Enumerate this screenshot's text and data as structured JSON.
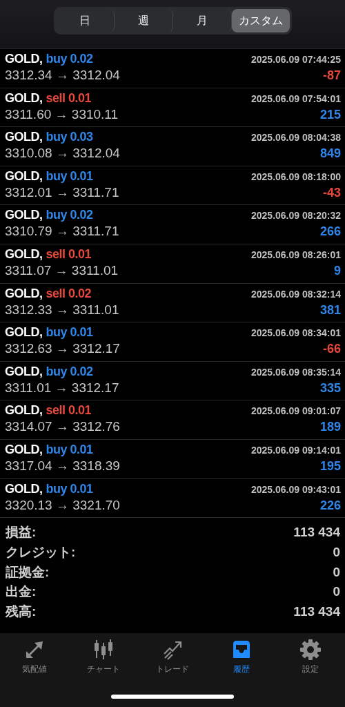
{
  "period_tabs": [
    {
      "label": "日",
      "selected": false
    },
    {
      "label": "週",
      "selected": false
    },
    {
      "label": "月",
      "selected": false
    },
    {
      "label": "カスタム",
      "selected": true
    }
  ],
  "trades": [
    {
      "symbol": "GOLD,",
      "kind": "buy",
      "volume": "buy 0.02",
      "time": "2025.06.09 07:44:25",
      "prices": "3312.34 → 3312.04",
      "profit": "-87",
      "color": "#e5483c"
    },
    {
      "symbol": "GOLD,",
      "kind": "sell",
      "volume": "sell 0.01",
      "time": "2025.06.09 07:54:01",
      "prices": "3311.60 → 3310.11",
      "profit": "215",
      "color": "#2f86e8"
    },
    {
      "symbol": "GOLD,",
      "kind": "buy",
      "volume": "buy 0.03",
      "time": "2025.06.09 08:04:38",
      "prices": "3310.08 → 3312.04",
      "profit": "849",
      "color": "#2f86e8"
    },
    {
      "symbol": "GOLD,",
      "kind": "buy",
      "volume": "buy 0.01",
      "time": "2025.06.09 08:18:00",
      "prices": "3312.01 → 3311.71",
      "profit": "-43",
      "color": "#e5483c"
    },
    {
      "symbol": "GOLD,",
      "kind": "buy",
      "volume": "buy 0.02",
      "time": "2025.06.09 08:20:32",
      "prices": "3310.79 → 3311.71",
      "profit": "266",
      "color": "#2f86e8"
    },
    {
      "symbol": "GOLD,",
      "kind": "sell",
      "volume": "sell 0.01",
      "time": "2025.06.09 08:26:01",
      "prices": "3311.07 → 3311.01",
      "profit": "9",
      "color": "#2f86e8"
    },
    {
      "symbol": "GOLD,",
      "kind": "sell",
      "volume": "sell 0.02",
      "time": "2025.06.09 08:32:14",
      "prices": "3312.33 → 3311.01",
      "profit": "381",
      "color": "#2f86e8"
    },
    {
      "symbol": "GOLD,",
      "kind": "buy",
      "volume": "buy 0.01",
      "time": "2025.06.09 08:34:01",
      "prices": "3312.63 → 3312.17",
      "profit": "-66",
      "color": "#e5483c"
    },
    {
      "symbol": "GOLD,",
      "kind": "buy",
      "volume": "buy 0.02",
      "time": "2025.06.09 08:35:14",
      "prices": "3311.01 → 3312.17",
      "profit": "335",
      "color": "#2f86e8"
    },
    {
      "symbol": "GOLD,",
      "kind": "sell",
      "volume": "sell 0.01",
      "time": "2025.06.09 09:01:07",
      "prices": "3314.07 → 3312.76",
      "profit": "189",
      "color": "#2f86e8"
    },
    {
      "symbol": "GOLD,",
      "kind": "buy",
      "volume": "buy 0.01",
      "time": "2025.06.09 09:14:01",
      "prices": "3317.04 → 3318.39",
      "profit": "195",
      "color": "#2f86e8"
    },
    {
      "symbol": "GOLD,",
      "kind": "buy",
      "volume": "buy 0.01",
      "time": "2025.06.09 09:43:01",
      "prices": "3320.13 → 3321.70",
      "profit": "226",
      "color": "#2f86e8"
    }
  ],
  "summary": [
    {
      "label": "損益:",
      "value": "113 434"
    },
    {
      "label": "クレジット:",
      "value": "0"
    },
    {
      "label": "証拠金:",
      "value": "0"
    },
    {
      "label": "出金:",
      "value": "0"
    },
    {
      "label": "残高:",
      "value": "113 434"
    }
  ],
  "tab_bar": [
    {
      "label": "気配値",
      "selected": false
    },
    {
      "label": "チャート",
      "selected": false
    },
    {
      "label": "トレード",
      "selected": false
    },
    {
      "label": "履歴",
      "selected": true
    },
    {
      "label": "設定",
      "selected": false
    }
  ]
}
